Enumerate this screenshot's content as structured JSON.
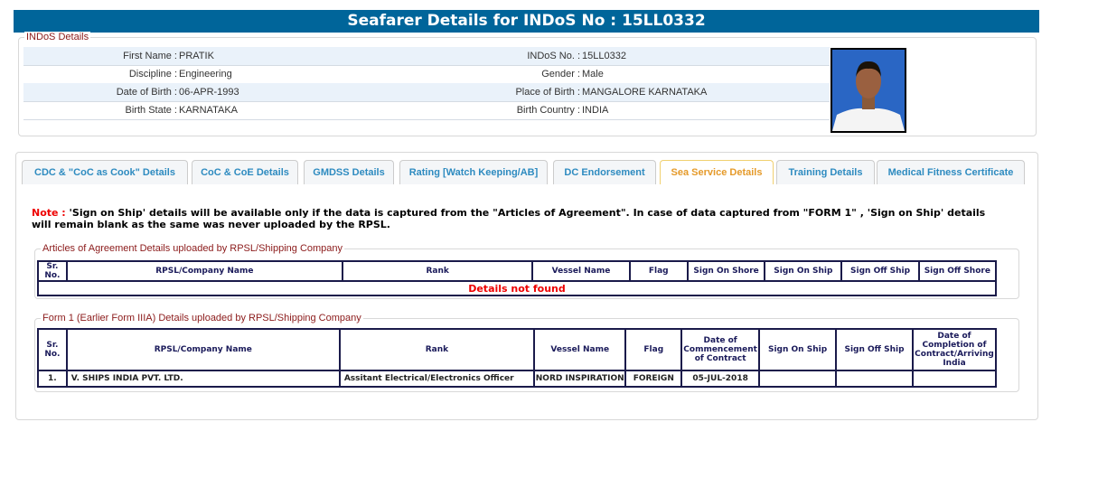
{
  "title": "Seafarer Details for INDoS No : 15LL0332",
  "indos": {
    "legend": "INDoS Details",
    "rows": [
      {
        "l1": "First Name :",
        "v1": "PRATIK",
        "l2": "INDoS No. :",
        "v2": "15LL0332"
      },
      {
        "l1": "Discipline :",
        "v1": "Engineering",
        "l2": "Gender :",
        "v2": "Male"
      },
      {
        "l1": "Date of Birth :",
        "v1": "06-APR-1993",
        "l2": "Place of Birth :",
        "v2": "MANGALORE KARNATAKA"
      },
      {
        "l1": "Birth State :",
        "v1": "KARNATAKA",
        "l2": "Birth Country :",
        "v2": "INDIA"
      }
    ]
  },
  "tabs": [
    "CDC & \"CoC as Cook\" Details",
    "CoC & CoE Details",
    "GMDSS Details",
    "Rating [Watch Keeping/AB]",
    "DC Endorsement",
    "Sea Service Details",
    "Training Details",
    "Medical Fitness Certificate"
  ],
  "note": {
    "label": "Note :",
    "text": " 'Sign on Ship' details will be available only if the data is captured from the \"Articles of Agreement\". In case of data captured from \"FORM 1\" , 'Sign on Ship' details will remain blank as the same was never uploaded by the RPSL."
  },
  "aoa": {
    "legend": "Articles of Agreement Details uploaded by RPSL/Shipping Company",
    "headers": [
      "Sr. No.",
      "RPSL/Company Name",
      "Rank",
      "Vessel Name",
      "Flag",
      "Sign On Shore",
      "Sign On Ship",
      "Sign Off Ship",
      "Sign Off Shore"
    ],
    "empty": "Details not found"
  },
  "form1": {
    "legend": "Form 1 (Earlier Form IIIA) Details uploaded by RPSL/Shipping Company",
    "headers": [
      "Sr. No.",
      "RPSL/Company Name",
      "Rank",
      "Vessel Name",
      "Flag",
      "Date of Commencement of Contract",
      "Sign On Ship",
      "Sign Off Ship",
      "Date of Completion of Contract/Arriving India"
    ],
    "rows": [
      [
        "1.",
        "V. SHIPS INDIA PVT. LTD.",
        "Assitant Electrical/Electronics Officer",
        "NORD INSPIRATION",
        "FOREIGN",
        "05-JUL-2018",
        "",
        "",
        ""
      ]
    ]
  }
}
